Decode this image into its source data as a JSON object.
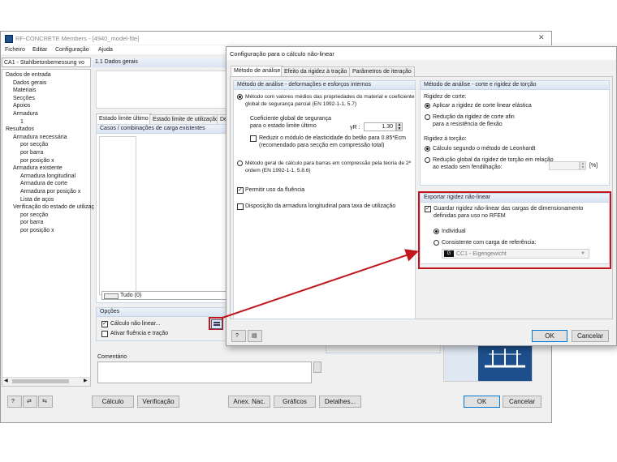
{
  "main": {
    "title": "RF-CONCRETE Members - [4940_model-file]",
    "menu": [
      "Ficheiro",
      "Editar",
      "Configuração",
      "Ajuda"
    ],
    "case_select": "CA1 - Stahlbetonbemessung vo",
    "section_header": "1.1 Dados gerais",
    "tree": [
      {
        "label": "Dados de entrada",
        "level": 0
      },
      {
        "label": "Dados gerais",
        "level": 1
      },
      {
        "label": "Materiais",
        "level": 1
      },
      {
        "label": "Secções",
        "level": 1
      },
      {
        "label": "Apoios",
        "level": 1
      },
      {
        "label": "Armadura",
        "level": 1
      },
      {
        "label": "1",
        "level": 2
      },
      {
        "label": "Resultados",
        "level": 0
      },
      {
        "label": "Armadura necessária",
        "level": 1
      },
      {
        "label": "por secção",
        "level": 2
      },
      {
        "label": "por barra",
        "level": 2
      },
      {
        "label": "por posição x",
        "level": 2
      },
      {
        "label": "Armadura existente",
        "level": 1
      },
      {
        "label": "Armadura longitudinal",
        "level": 2
      },
      {
        "label": "Armadura de corte",
        "level": 2
      },
      {
        "label": "Armadura por posição x",
        "level": 2
      },
      {
        "label": "Lista de aços",
        "level": 2
      },
      {
        "label": "Verificação do estado de utilizaç",
        "level": 1
      },
      {
        "label": "por secção",
        "level": 2
      },
      {
        "label": "por barra",
        "level": 2
      },
      {
        "label": "por posição x",
        "level": 2
      }
    ],
    "tabs": [
      "Estado limite último",
      "Estado limite de utilização",
      "De"
    ],
    "cases_header": "Casos / combinações de carga existentes",
    "all_select": "Tudo (0)",
    "options_header": "Opções",
    "option_nonlinear": "Cálculo não linear...",
    "option_creep": "Ativar fluência e tração",
    "comment_header": "Comentário",
    "buttons": {
      "calc": "Cálculo",
      "verify": "Verificação",
      "anex": "Anex. Nac.",
      "graphs": "Gráficos",
      "details": "Detalhes...",
      "ok": "OK",
      "cancel": "Cancelar"
    }
  },
  "dialog": {
    "title": "Configuração para o cálculo não-linear",
    "tabs": [
      "Método de análise",
      "Efeito da rigidez à tração",
      "Parâmetros de iteração"
    ],
    "left_panel": {
      "header": "Método de análise - deformações e esforços internos",
      "radio1_line1": "Método com valores médios das propriedades do material e coeficiente",
      "radio1_line2": "global de segurança parcial (EN 1992-1-1, 5.7)",
      "coef_line1": "Coeficiente global de segurança",
      "coef_line2": "para o estado limite último",
      "gamma_label": "γR :",
      "gamma_value": "1.30",
      "reduce_line1": "Reduzir o módulo de elasticidade do betão para 0.85*Ecm",
      "reduce_line2": "(recomendado para secção em compressão total)",
      "radio2_line1": "Método geral de cálculo para barras em compressão pela teoria de 2ª",
      "radio2_line2": "ordem (EN 1992-1-1, 5.8.6)",
      "creep": "Permitir uso da fluência",
      "layout": "Disposição da armadura longitudinal para taxa de utilização"
    },
    "right_panel": {
      "header": "Método de análise - corte e rigidez de torção",
      "shear_label": "Rigidez de corte:",
      "shear_opt1": "Aplicar a rigidez de corte linear elástica",
      "shear_opt2_line1": "Redução da rigidez de corte afin",
      "shear_opt2_line2": "para a resistência de flexão",
      "torsion_label": "Rigidez à torção:",
      "torsion_opt1": "Cálculo segundo o método de Leonhardt",
      "torsion_opt2_line1": "Redução global da rigidez de torção em relação",
      "torsion_opt2_line2": "ao estado sem fendilhação:",
      "torsion_unit": "[%]"
    },
    "export_panel": {
      "header": "Exportar rigidez não-linear",
      "save_line1": "Guardar rigidez não-linear das cargas de dimensionamento",
      "save_line2": "definidas para uso no RFEM",
      "individual": "Individual",
      "consistent": "Consistente com carga de referência:",
      "lc_tag": "G",
      "lc_value": "CC1 - Eigengewicht"
    },
    "buttons": {
      "ok": "OK",
      "cancel": "Cancelar"
    }
  },
  "colors": {
    "highlight": "#c0161c",
    "accent": "#0078d7"
  }
}
